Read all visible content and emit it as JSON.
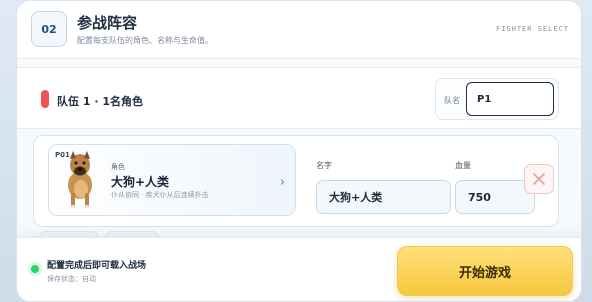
{
  "header": {
    "step": "02",
    "title": "参战阵容",
    "subtitle": "配置每支队伍的角色、名称与生命值。",
    "tag": "FIGHTER SELECT"
  },
  "team": {
    "title": "队伍 1 · 1名角色",
    "name_label": "队名",
    "name_value": "P1",
    "accent": "#ef5353"
  },
  "fighter": {
    "id": "P01",
    "role_label": "角色",
    "role_name": "大狗+人类",
    "role_desc": "仆从协同 · 疾犬仆从后连续扑击",
    "name_label": "名字",
    "name_value": "大狗+人类",
    "hp_label": "血量",
    "hp_value": "750"
  },
  "footer": {
    "status_main": "配置完成后即可载入战场",
    "status_sub": "保存状态：自动",
    "start_label": "开始游戏",
    "status_color": "#2fcf6a",
    "button_color": "#f7c83f"
  },
  "icons": {
    "remove": "close-icon",
    "chevron": "chevron-right-icon",
    "portrait": "dog-portrait"
  }
}
